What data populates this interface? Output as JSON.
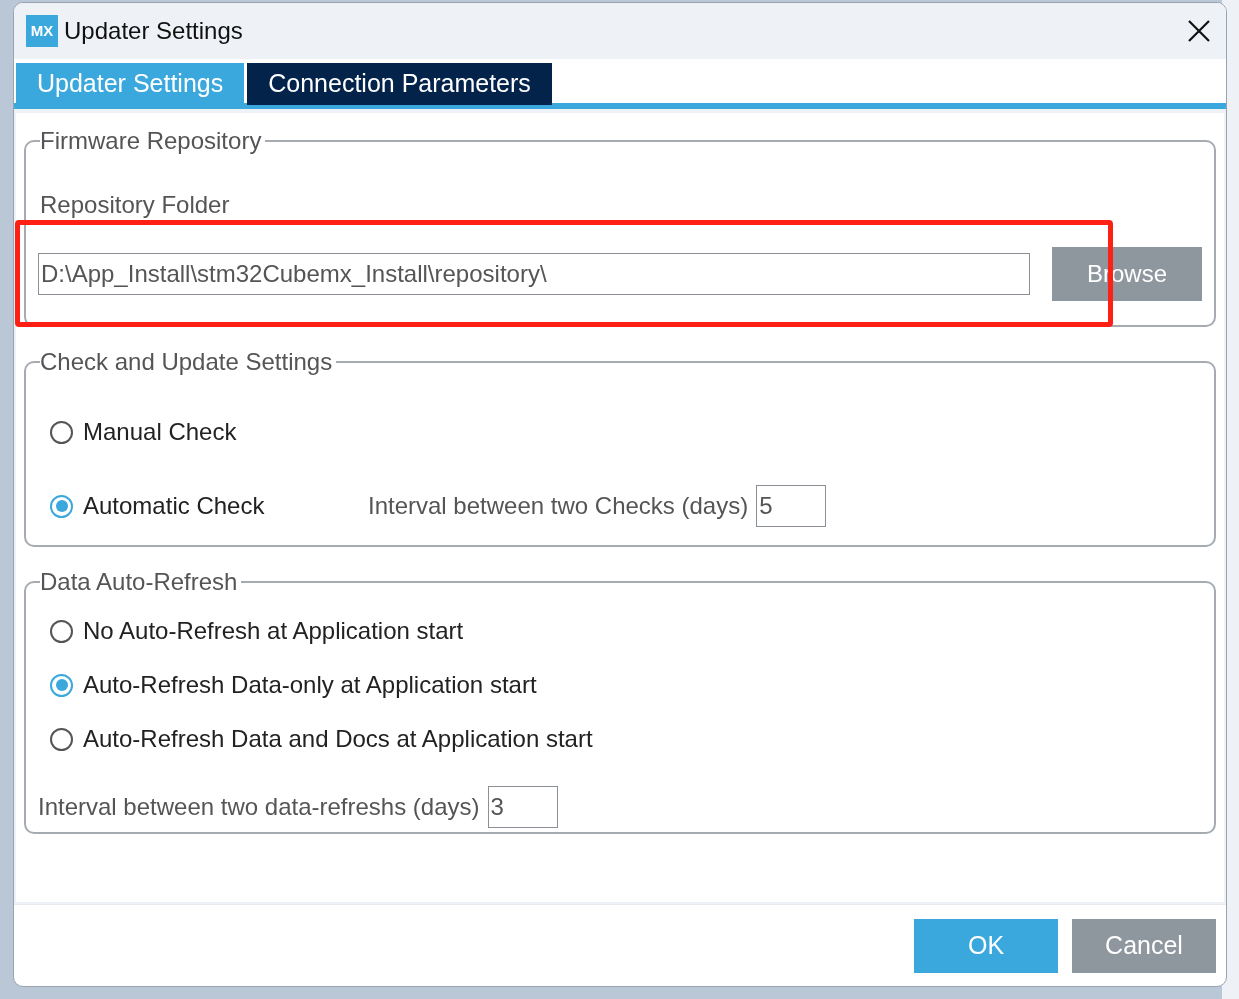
{
  "window": {
    "title": "Updater Settings",
    "logo": "MX"
  },
  "tabs": [
    {
      "label": "Updater Settings",
      "selected": true
    },
    {
      "label": "Connection Parameters",
      "selected": false
    }
  ],
  "firmware_repository": {
    "legend": "Firmware Repository",
    "folder_label": "Repository Folder",
    "folder_value": "D:\\App_Install\\stm32Cubemx_Install\\repository\\",
    "browse_button": "Browse"
  },
  "check_settings": {
    "legend": "Check and Update Settings",
    "options": [
      {
        "label": "Manual Check",
        "selected": false
      },
      {
        "label": "Automatic Check",
        "selected": true
      }
    ],
    "interval_label": "Interval between two Checks (days)",
    "interval_value": "5"
  },
  "auto_refresh": {
    "legend": "Data Auto-Refresh",
    "options": [
      {
        "label": "No Auto-Refresh at Application start",
        "selected": false
      },
      {
        "label": "Auto-Refresh Data-only at Application start",
        "selected": true
      },
      {
        "label": "Auto-Refresh Data and Docs at Application start",
        "selected": false
      }
    ],
    "interval_label": "Interval between two data-refreshs (days)",
    "interval_value": "3"
  },
  "buttons": [
    {
      "label": "OK",
      "kind": "primary"
    },
    {
      "label": "Cancel",
      "kind": "secondary"
    }
  ],
  "annotations": [
    {
      "kind": "rectangle"
    }
  ]
}
